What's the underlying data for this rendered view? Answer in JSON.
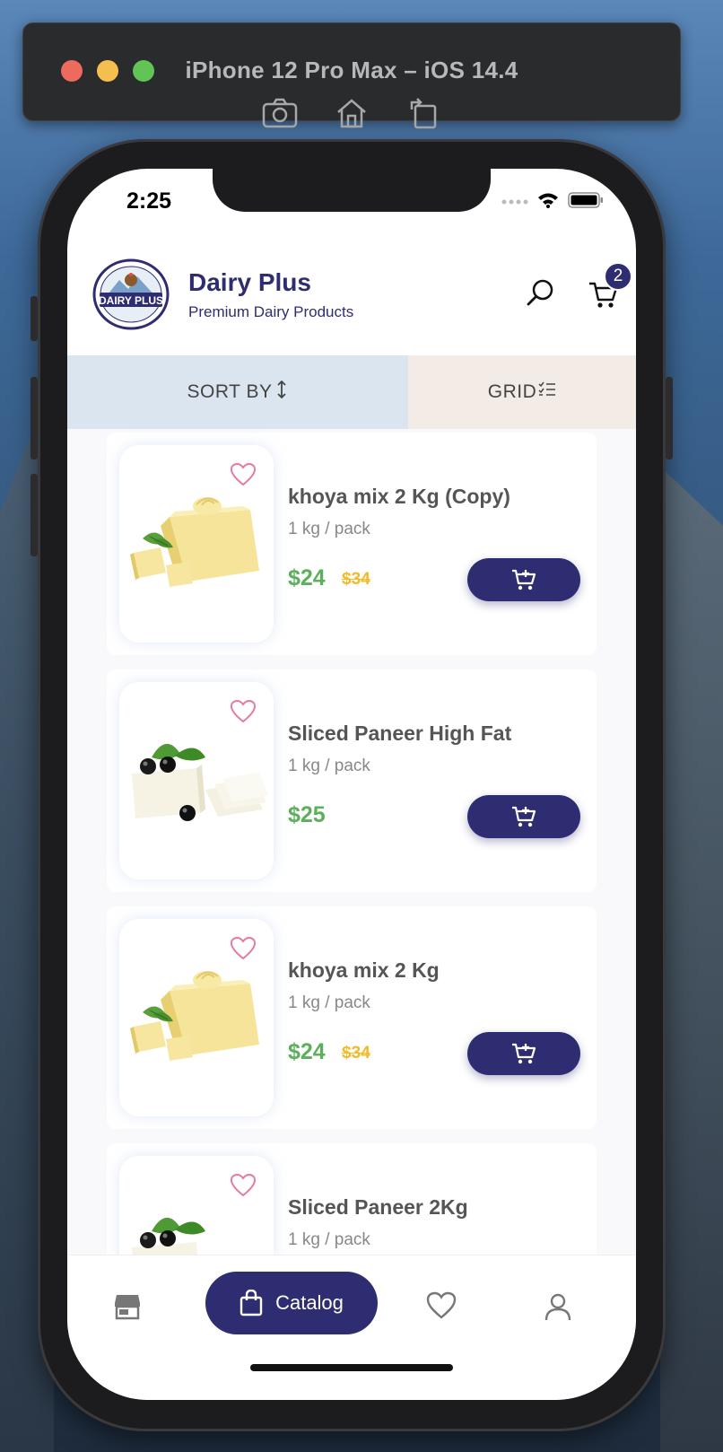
{
  "simulator": {
    "title": "iPhone 12 Pro Max – iOS 14.4",
    "tools": [
      "screenshot-icon",
      "home-icon",
      "rotate-icon"
    ]
  },
  "status_bar": {
    "time": "2:25",
    "icons": [
      "signal-icon",
      "wifi-icon",
      "battery-icon"
    ]
  },
  "header": {
    "logo_text": "DAIRY PLUS",
    "title": "Dairy Plus",
    "subtitle": "Premium Dairy Products",
    "cart_count": "2"
  },
  "toolbar": {
    "sort_label": "SORT BY",
    "grid_label": "GRID"
  },
  "products": [
    {
      "name": "khoya mix 2 Kg (Copy)",
      "unit": "1 kg / pack",
      "price": "$24",
      "old_price": "$34",
      "image": "butter"
    },
    {
      "name": "Sliced Paneer High Fat",
      "unit": "1 kg / pack",
      "price": "$25",
      "old_price": "",
      "image": "paneer"
    },
    {
      "name": "khoya mix 2 Kg",
      "unit": "1 kg / pack",
      "price": "$24",
      "old_price": "$34",
      "image": "butter"
    },
    {
      "name": "Sliced Paneer 2Kg",
      "unit": "1 kg / pack",
      "price": "",
      "old_price": "",
      "image": "paneer"
    }
  ],
  "bottom_nav": {
    "catalog_label": "Catalog",
    "items": [
      "store-icon",
      "catalog-bag-icon",
      "heart-icon",
      "profile-icon"
    ]
  },
  "colors": {
    "primary": "#2f2d72",
    "price_green": "#5cb05c",
    "old_price_yellow": "#f2b928",
    "sort_bg": "#dbe5ef",
    "grid_bg": "#f3ebe5",
    "heart_pink": "#e67aa3"
  }
}
